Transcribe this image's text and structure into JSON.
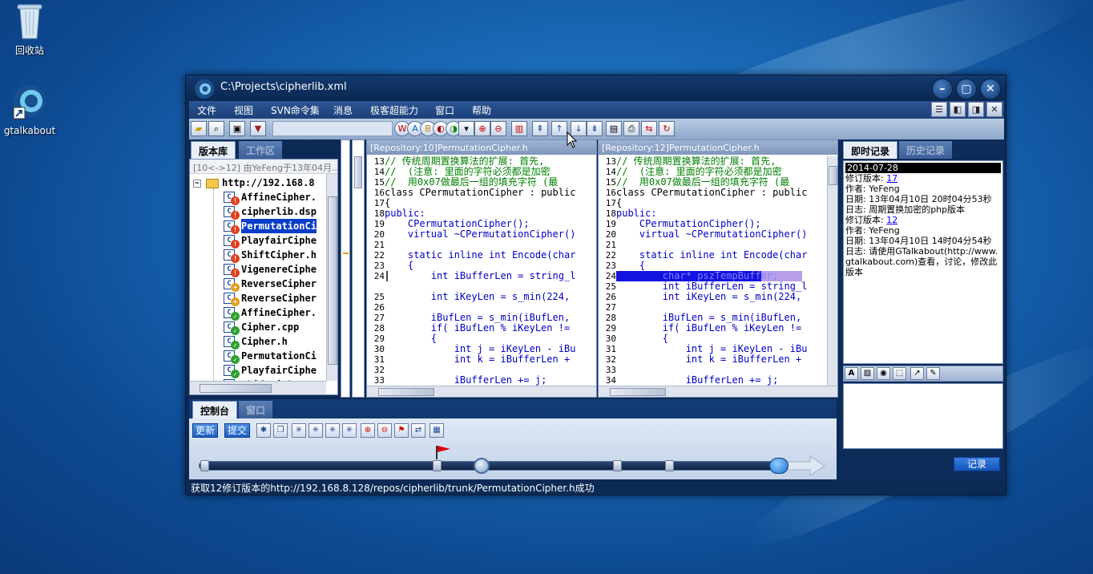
{
  "desktop": {
    "icons": [
      {
        "label": "回收站"
      },
      {
        "label": "gtalkabout"
      }
    ]
  },
  "window": {
    "title": "C:\\Projects\\cipherlib.xml",
    "menu": [
      "文件",
      "视图",
      "SVN命令集",
      "消息",
      "极客超能力",
      "窗口",
      "帮助"
    ]
  },
  "left_panel": {
    "tabs": [
      "版本库",
      "工作区"
    ],
    "header": "[10<->12] 由YeFeng于13年04月...",
    "root": "http://192.168.8",
    "files": [
      {
        "name": "AffineCipher.",
        "status": "modified"
      },
      {
        "name": "cipherlib.dsp",
        "status": "modified"
      },
      {
        "name": "PermutationCi",
        "status": "modified",
        "selected": true
      },
      {
        "name": "PlayfairCiphe",
        "status": "modified"
      },
      {
        "name": "ShiftCipher.h",
        "status": "modified"
      },
      {
        "name": "VigenereCiphe",
        "status": "modified"
      },
      {
        "name": "ReverseCipher",
        "status": "added"
      },
      {
        "name": "ReverseCipher",
        "status": "added"
      },
      {
        "name": "AffineCipher.",
        "status": "ok"
      },
      {
        "name": "Cipher.cpp",
        "status": "ok"
      },
      {
        "name": "Cipher.h",
        "status": "ok"
      },
      {
        "name": "PermutationCi",
        "status": "ok"
      },
      {
        "name": "PlayfairCiphe",
        "status": "ok"
      },
      {
        "name": "ShiftCipher.",
        "status": "ok"
      }
    ]
  },
  "diff": {
    "left": {
      "header": "[Repository:10]PermutationCipher.h",
      "lines": [
        {
          "n": "13",
          "t": "// 传统周期置换算法的扩展: 首先,",
          "k": "cm"
        },
        {
          "n": "14",
          "t": "//  (注意: 里面的字符必须都是加密",
          "k": "cm"
        },
        {
          "n": "15",
          "t": "//  用0x07做最后一组的填充字符 (最",
          "k": "cm"
        },
        {
          "n": "16",
          "t": "class CPermutationCipher : public",
          "k": ""
        },
        {
          "n": "17",
          "t": "{",
          "k": ""
        },
        {
          "n": "18",
          "t": "public:",
          "k": "kw"
        },
        {
          "n": "19",
          "t": "    CPermutationCipher();",
          "k": "kw"
        },
        {
          "n": "20",
          "t": "    virtual ~CPermutationCipher()",
          "k": "kw"
        },
        {
          "n": "21",
          "t": "",
          "k": ""
        },
        {
          "n": "22",
          "t": "    static inline int Encode(char",
          "k": "kw"
        },
        {
          "n": "23",
          "t": "    {",
          "k": "kw"
        },
        {
          "n": "24",
          "t": "        int iBufferLen = string_l",
          "k": "kw"
        },
        {
          "n": "",
          "t": "",
          "k": ""
        },
        {
          "n": "25",
          "t": "        int iKeyLen = s_min(224,",
          "k": "kw"
        },
        {
          "n": "26",
          "t": "",
          "k": ""
        },
        {
          "n": "27",
          "t": "        iBufLen = s_min(iBufLen,",
          "k": "kw"
        },
        {
          "n": "28",
          "t": "        if( iBufLen % iKeyLen !=",
          "k": "kw"
        },
        {
          "n": "29",
          "t": "        {",
          "k": "kw"
        },
        {
          "n": "30",
          "t": "            int j = iKeyLen - iBu",
          "k": "kw"
        },
        {
          "n": "31",
          "t": "            int k = iBufferLen +",
          "k": "kw"
        },
        {
          "n": "32",
          "t": "",
          "k": ""
        },
        {
          "n": "33",
          "t": "            iBufferLen += j;",
          "k": "kw"
        }
      ]
    },
    "right": {
      "header": "[Repository:12]PermutationCipher.h",
      "lines": [
        {
          "n": "13",
          "t": "// 传统周期置换算法的扩展: 首先,",
          "k": "cm"
        },
        {
          "n": "14",
          "t": "//  (注意: 里面的字符必须都是加密",
          "k": "cm"
        },
        {
          "n": "15",
          "t": "//  用0x07做最后一组的填充字符 (最",
          "k": "cm"
        },
        {
          "n": "16",
          "t": "class CPermutationCipher : public",
          "k": ""
        },
        {
          "n": "17",
          "t": "{",
          "k": ""
        },
        {
          "n": "18",
          "t": "public:",
          "k": "kw"
        },
        {
          "n": "19",
          "t": "    CPermutationCipher();",
          "k": "kw"
        },
        {
          "n": "20",
          "t": "    virtual ~CPermutationCipher()",
          "k": "kw"
        },
        {
          "n": "21",
          "t": "",
          "k": ""
        },
        {
          "n": "22",
          "t": "    static inline int Encode(char",
          "k": "kw"
        },
        {
          "n": "23",
          "t": "    {",
          "k": "kw"
        },
        {
          "n": "24",
          "t": "        char* pszTempBuffer;",
          "k": "hl"
        },
        {
          "n": "25",
          "t": "        int iBufferLen = string_l",
          "k": "kw"
        },
        {
          "n": "26",
          "t": "        int iKeyLen = s_min(224,",
          "k": "kw"
        },
        {
          "n": "27",
          "t": "",
          "k": ""
        },
        {
          "n": "28",
          "t": "        iBufLen = s_min(iBufLen,",
          "k": "kw"
        },
        {
          "n": "29",
          "t": "        if( iBufLen % iKeyLen !=",
          "k": "kw"
        },
        {
          "n": "30",
          "t": "        {",
          "k": "kw"
        },
        {
          "n": "31",
          "t": "            int j = iKeyLen - iBu",
          "k": "kw"
        },
        {
          "n": "32",
          "t": "            int k = iBufferLen +",
          "k": "kw"
        },
        {
          "n": "33",
          "t": "",
          "k": ""
        },
        {
          "n": "34",
          "t": "            iBufferLen += j;",
          "k": "kw"
        }
      ]
    }
  },
  "right_panel": {
    "tabs": [
      "即时记录",
      "历史记录"
    ],
    "log_date": "2014-07-28",
    "entries": [
      {
        "rev_label": "修订版本: ",
        "rev": "17",
        "author": "作者: YeFeng",
        "date": "日期: 13年04月10日 20时04分53秒",
        "log": "日志: 周期置换加密的php版本"
      },
      {
        "rev_label": "修订版本: ",
        "rev": "12",
        "author": "作者: YeFeng",
        "date": "日期: 13年04月10日 14时04分54秒",
        "log": "日志: 请使用GTalkabout(http://www.gtalkabout.com)查看，讨论，修改此版本"
      }
    ],
    "record_button": "记录"
  },
  "console": {
    "tabs": [
      "控制台",
      "窗口"
    ],
    "update_button": "更新",
    "commit_button": "提交",
    "slider_position": 0.48
  },
  "status": "获取12修订版本的http://192.168.8.128/repos/cipherlib/trunk/PermutationCipher.h成功",
  "colors": {
    "accent": "#1454b8",
    "titlebar": "#0a2750",
    "diff_highlight": "#1414e0"
  }
}
